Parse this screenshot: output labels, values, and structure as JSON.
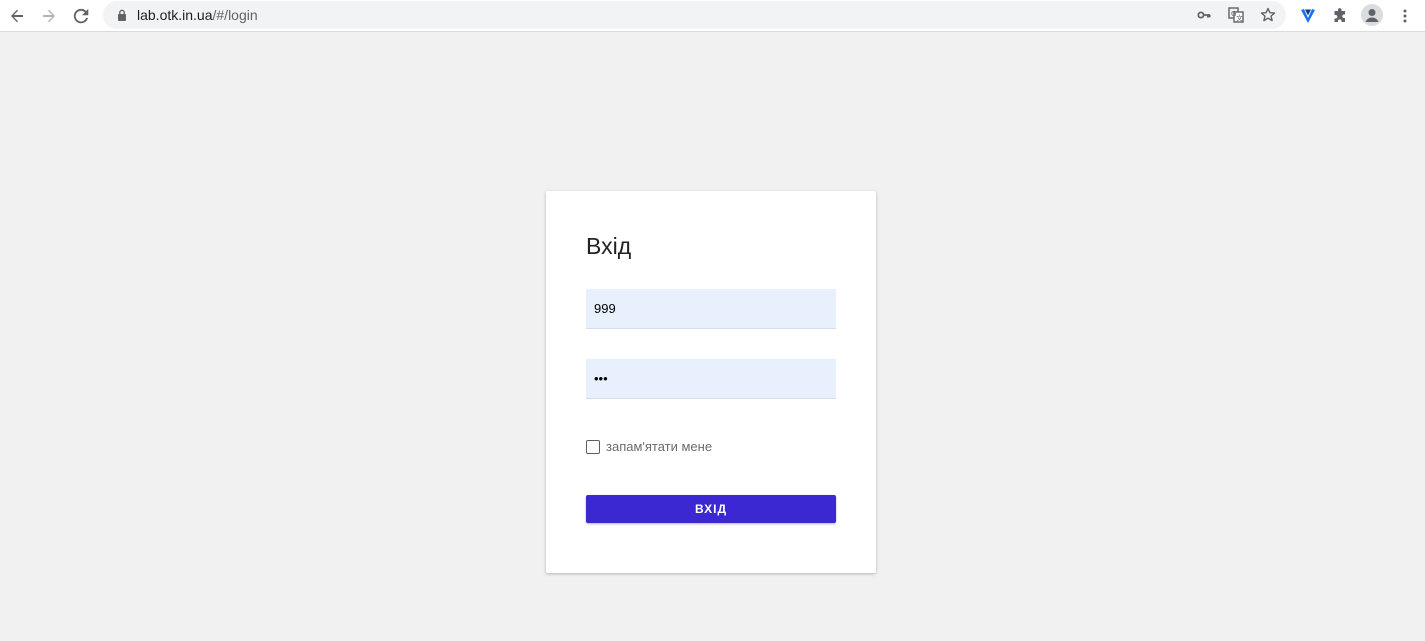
{
  "browser": {
    "url_host": "lab.otk.in.ua",
    "url_path": "/#/login",
    "icons": [
      "back-icon",
      "forward-icon",
      "reload-icon",
      "lock-icon",
      "key-icon",
      "translate-icon",
      "star-icon",
      "extension-v-icon",
      "puzzle-icon",
      "profile-icon",
      "menu-icon"
    ]
  },
  "login": {
    "title": "Вхід",
    "username_value": "999",
    "password_value": "•••",
    "remember_label": "запам'ятати мене",
    "remember_checked": false,
    "submit_label": "ВХІД"
  },
  "colors": {
    "page_bg": "#f1f1f1",
    "field_bg": "#e8f0fe",
    "button_bg": "#3b28d3"
  }
}
